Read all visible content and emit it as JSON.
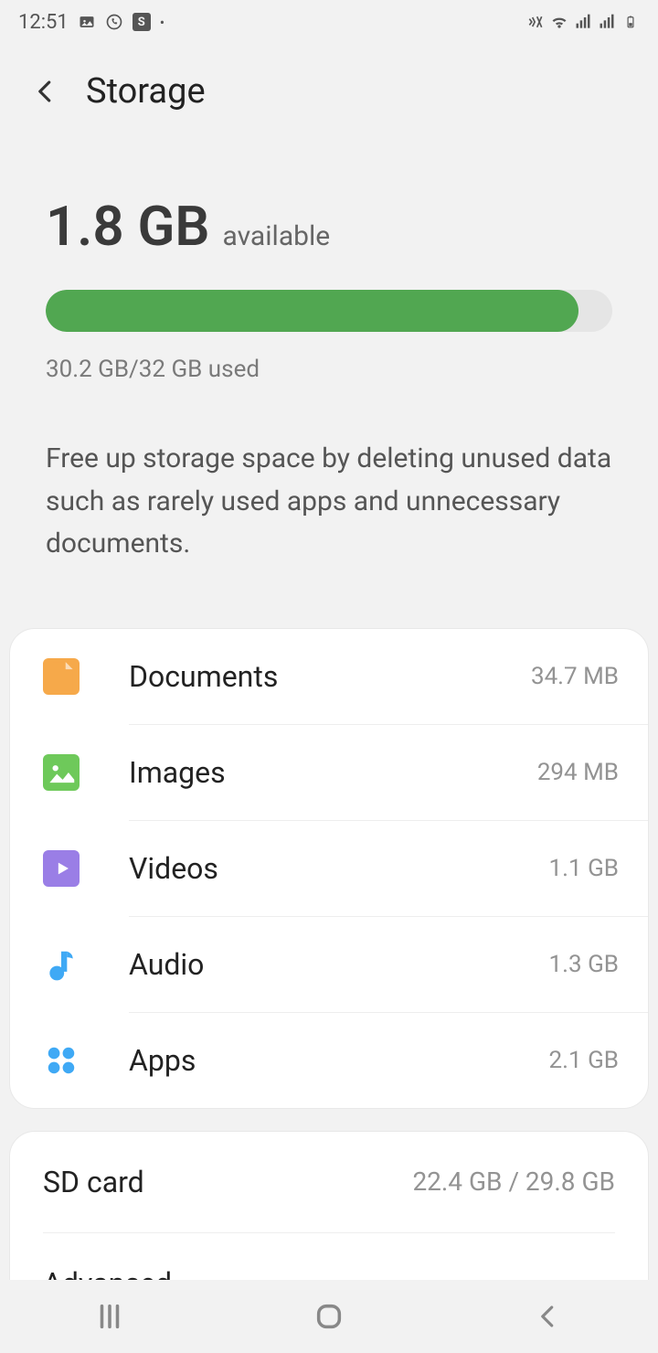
{
  "status": {
    "time": "12:51"
  },
  "header": {
    "title": "Storage"
  },
  "summary": {
    "available_amount": "1.8 GB",
    "available_label": "available",
    "used_text": "30.2 GB/32 GB used",
    "hint": "Free up storage space by deleting unused data such as rarely used apps and unnecessary documents.",
    "fill_percent": 94
  },
  "categories": [
    {
      "icon": "documents-icon",
      "label": "Documents",
      "size": "34.7 MB"
    },
    {
      "icon": "images-icon",
      "label": "Images",
      "size": "294 MB"
    },
    {
      "icon": "videos-icon",
      "label": "Videos",
      "size": "1.1 GB"
    },
    {
      "icon": "audio-icon",
      "label": "Audio",
      "size": "1.3 GB"
    },
    {
      "icon": "apps-icon",
      "label": "Apps",
      "size": "2.1 GB"
    }
  ],
  "extra": {
    "sdcard_label": "SD card",
    "sdcard_value": "22.4 GB / 29.8 GB",
    "advanced_label": "Advanced"
  }
}
